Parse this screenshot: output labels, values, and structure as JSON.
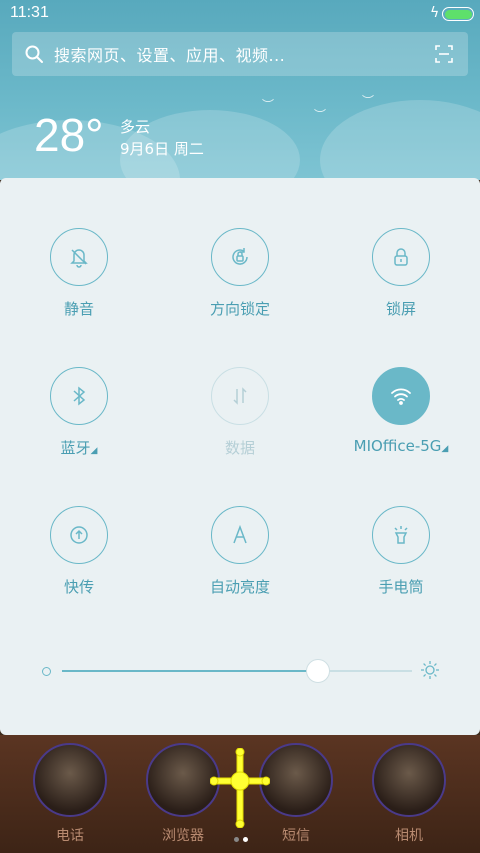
{
  "status_bar": {
    "time": "11:31",
    "charging_icon": "bolt-icon",
    "battery_color": "#5ee06b"
  },
  "search": {
    "placeholder": "搜索网页、设置、应用、视频..."
  },
  "weather": {
    "temperature": "28°",
    "condition": "多云",
    "date": "9月6日 周二"
  },
  "toggles": [
    {
      "label": "静音",
      "icon": "bell-off-icon",
      "state": "off"
    },
    {
      "label": "方向锁定",
      "icon": "rotation-lock-icon",
      "state": "off"
    },
    {
      "label": "锁屏",
      "icon": "lock-icon",
      "state": "off"
    },
    {
      "label": "蓝牙",
      "icon": "bluetooth-icon",
      "state": "off"
    },
    {
      "label": "数据",
      "icon": "mobile-data-icon",
      "state": "disabled"
    },
    {
      "label": "MIOffice-5G",
      "icon": "wifi-icon",
      "state": "on"
    },
    {
      "label": "快传",
      "icon": "quick-transfer-icon",
      "state": "off"
    },
    {
      "label": "自动亮度",
      "icon": "auto-brightness-icon",
      "state": "off"
    },
    {
      "label": "手电筒",
      "icon": "flashlight-icon",
      "state": "off"
    }
  ],
  "brightness": {
    "level": 0.73
  },
  "dock": {
    "apps": [
      {
        "label": "电话"
      },
      {
        "label": "浏览器"
      },
      {
        "label": "短信"
      },
      {
        "label": "相机"
      }
    ],
    "page_indicator": {
      "pages": 2,
      "current": 2
    }
  },
  "colors": {
    "accent": "#6ab8c8",
    "header": "#6bb8c9",
    "panel": "#eaf1f3",
    "cursor": "#ffff33"
  }
}
